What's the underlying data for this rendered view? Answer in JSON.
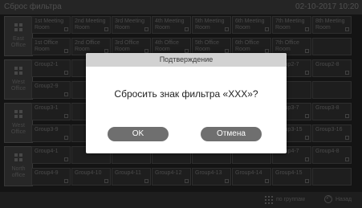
{
  "topbar": {
    "title": "Сброс фильтра",
    "datetime": "02-10-2017  10:20"
  },
  "groups": [
    {
      "label": "East Office",
      "rows": [
        [
          "1st Meeting Room",
          "2nd Meeting Room",
          "3rd Meeting Room",
          "4th Meeting Room",
          "5th Meeting Room",
          "6th Meeting Room",
          "7th Meeting Room",
          "8th Meeting Room"
        ],
        [
          "1st Office Room",
          "2nd Office Room",
          "3rd Office Room",
          "4th Office Room",
          "5th Office Room",
          "6th Office Room",
          "7th Office Room",
          ""
        ]
      ]
    },
    {
      "label": "West Office",
      "rows": [
        [
          "Group2-1",
          "",
          "",
          "",
          "",
          "",
          "Group2-7",
          "Group2-8"
        ],
        [
          "Group2-9",
          "",
          "",
          "",
          "",
          "",
          "",
          ""
        ]
      ]
    },
    {
      "label": "West Office",
      "rows": [
        [
          "Group3-1",
          "",
          "",
          "",
          "",
          "",
          "Group3-7",
          "Group3-8"
        ],
        [
          "Group3-9",
          "",
          "",
          "",
          "",
          "",
          "Group3-15",
          "Group3-16"
        ]
      ]
    },
    {
      "label": "North office",
      "rows": [
        [
          "Group4-1",
          "",
          "",
          "",
          "",
          "",
          "Group4-7",
          "Group4-8"
        ],
        [
          "Group4-9",
          "Group4-10",
          "Group4-11",
          "Group4-12",
          "Group4-13",
          "Group4-14",
          "Group4-15",
          ""
        ]
      ]
    }
  ],
  "bottombar": {
    "by_group": "по группам",
    "back": "Назад"
  },
  "dialog": {
    "title": "Подтверждение",
    "message": "Сбросить знак фильтра «XXX»?",
    "ok": "OK",
    "cancel": "Отмена"
  },
  "icons": {
    "group": "grid-icon",
    "cell": "square-icon",
    "by_group": "dots-grid-icon",
    "back": "back-arrow-icon"
  }
}
